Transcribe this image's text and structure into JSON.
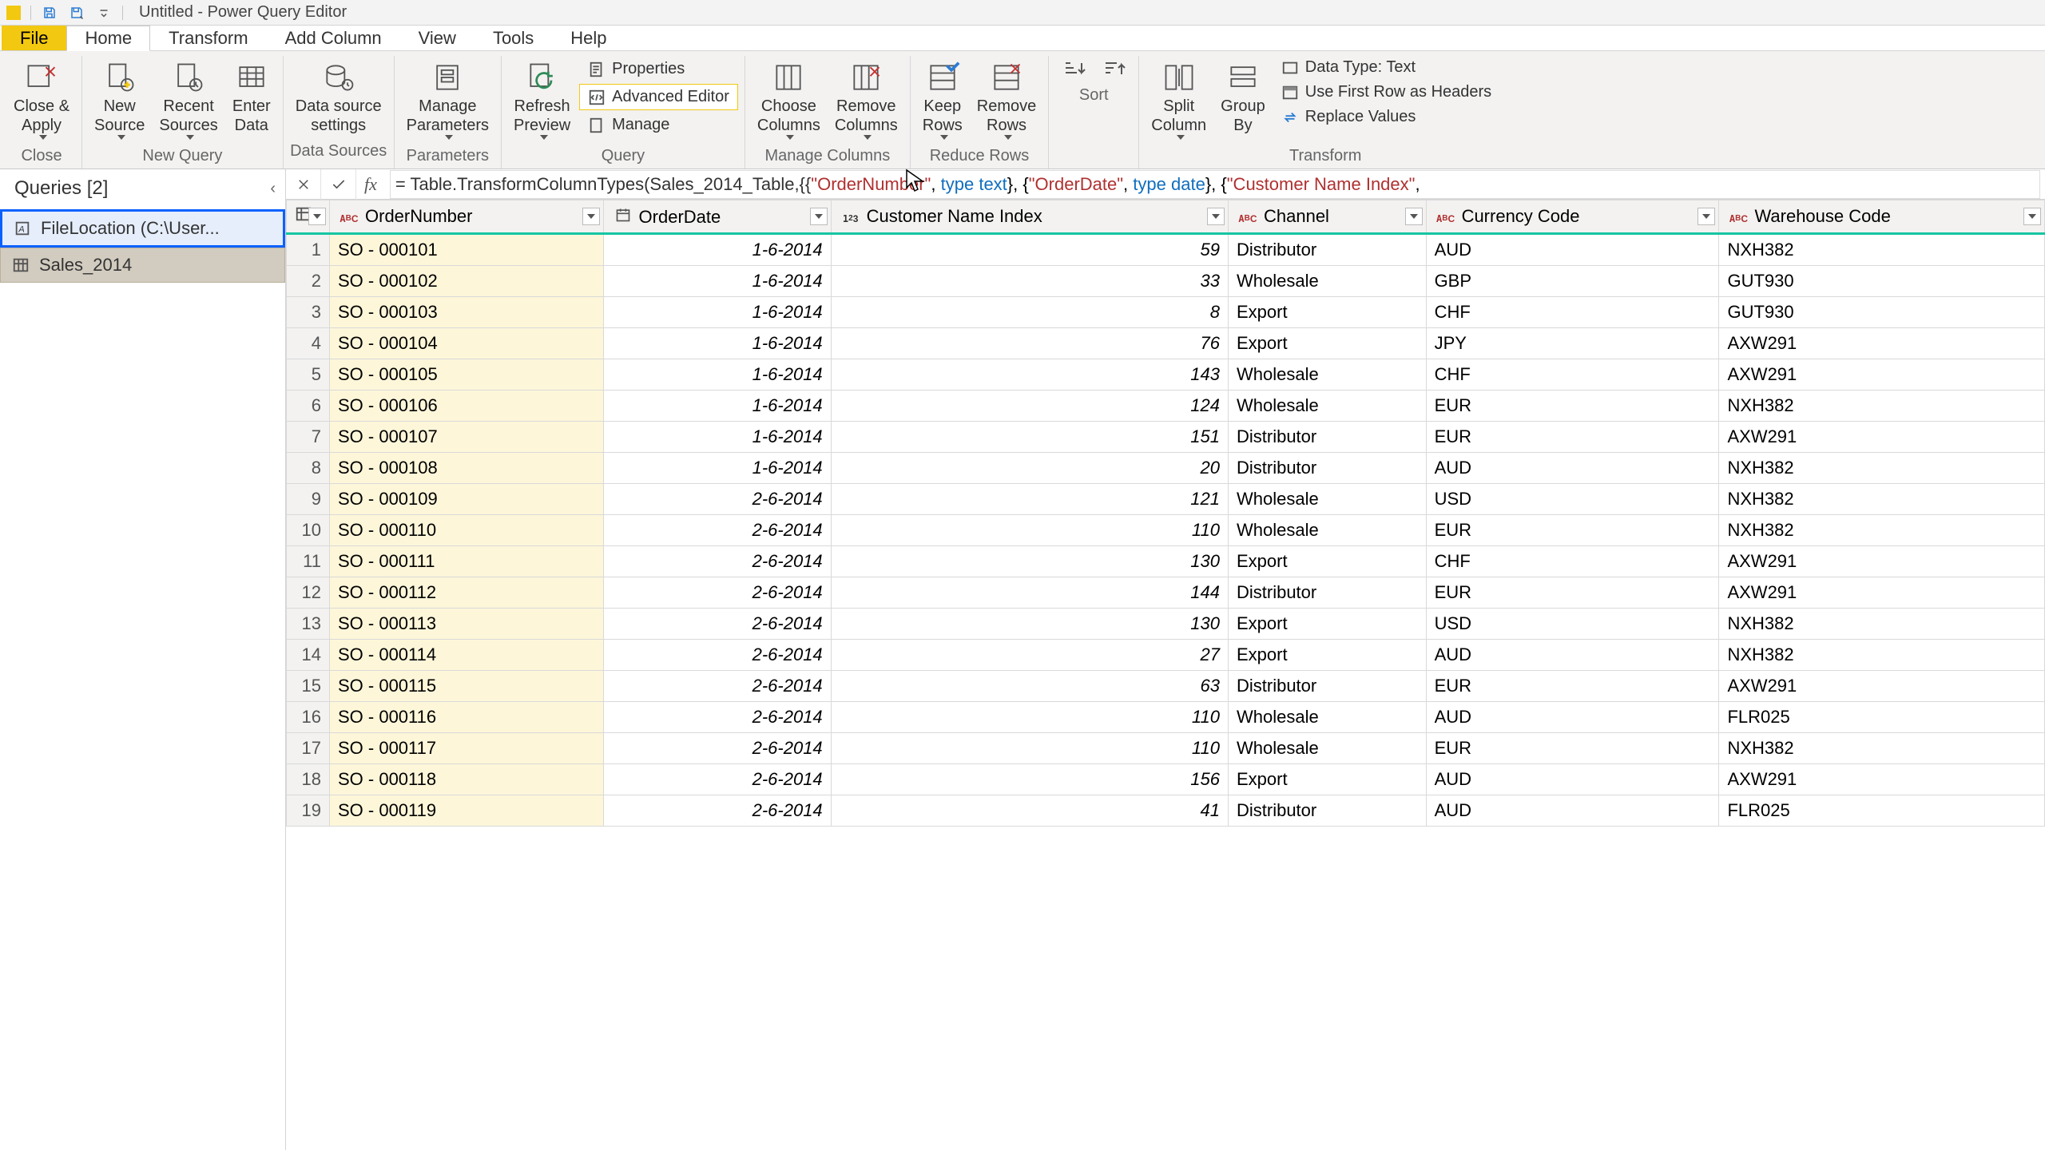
{
  "window": {
    "title": "Untitled - Power Query Editor"
  },
  "menu": {
    "file": "File",
    "tabs": [
      "Home",
      "Transform",
      "Add Column",
      "View",
      "Tools",
      "Help"
    ],
    "active": "Home"
  },
  "ribbon": {
    "groups": {
      "close": {
        "label": "Close",
        "close_apply": "Close &\nApply"
      },
      "newquery": {
        "label": "New Query",
        "new_source": "New\nSource",
        "recent_sources": "Recent\nSources",
        "enter_data": "Enter\nData"
      },
      "datasources": {
        "label": "Data Sources",
        "settings": "Data source\nsettings"
      },
      "parameters": {
        "label": "Parameters",
        "manage": "Manage\nParameters"
      },
      "query": {
        "label": "Query",
        "refresh": "Refresh\nPreview",
        "properties": "Properties",
        "advanced": "Advanced Editor",
        "manageq": "Manage"
      },
      "cols": {
        "label": "Manage Columns",
        "choose": "Choose\nColumns",
        "remove": "Remove\nColumns"
      },
      "rows": {
        "label": "Reduce Rows",
        "keep": "Keep\nRows",
        "removerows": "Remove\nRows"
      },
      "sort": {
        "label": "Sort"
      },
      "transform": {
        "label": "Transform",
        "split": "Split\nColumn",
        "group": "Group\nBy",
        "datatype": "Data Type: Text",
        "firstrow": "Use First Row as Headers",
        "replace": "Replace Values"
      }
    }
  },
  "formula": {
    "prefix": "= Table.TransformColumnTypes(Sales_2014_Table,{{",
    "s1": "\"OrderNumber\"",
    "p1": ", ",
    "kw1": "type",
    "p1b": " ",
    "kw1b": "text",
    "p2": "}, {",
    "s2": "\"OrderDate\"",
    "p3": ", ",
    "kw2": "type",
    "p3b": " ",
    "kw2b": "date",
    "p4": "}, {",
    "s3": "\"Customer Name Index\"",
    "p5": ","
  },
  "queries": {
    "heading": "Queries [2]",
    "items": [
      {
        "label": "FileLocation (C:\\User..."
      },
      {
        "label": "Sales_2014"
      }
    ]
  },
  "columns": [
    "OrderNumber",
    "OrderDate",
    "Customer Name Index",
    "Channel",
    "Currency Code",
    "Warehouse Code"
  ],
  "rows": [
    {
      "n": 1,
      "OrderNumber": "SO - 000101",
      "OrderDate": "1-6-2014",
      "Customer Name Index": 59,
      "Channel": "Distributor",
      "Currency Code": "AUD",
      "Warehouse Code": "NXH382"
    },
    {
      "n": 2,
      "OrderNumber": "SO - 000102",
      "OrderDate": "1-6-2014",
      "Customer Name Index": 33,
      "Channel": "Wholesale",
      "Currency Code": "GBP",
      "Warehouse Code": "GUT930"
    },
    {
      "n": 3,
      "OrderNumber": "SO - 000103",
      "OrderDate": "1-6-2014",
      "Customer Name Index": 8,
      "Channel": "Export",
      "Currency Code": "CHF",
      "Warehouse Code": "GUT930"
    },
    {
      "n": 4,
      "OrderNumber": "SO - 000104",
      "OrderDate": "1-6-2014",
      "Customer Name Index": 76,
      "Channel": "Export",
      "Currency Code": "JPY",
      "Warehouse Code": "AXW291"
    },
    {
      "n": 5,
      "OrderNumber": "SO - 000105",
      "OrderDate": "1-6-2014",
      "Customer Name Index": 143,
      "Channel": "Wholesale",
      "Currency Code": "CHF",
      "Warehouse Code": "AXW291"
    },
    {
      "n": 6,
      "OrderNumber": "SO - 000106",
      "OrderDate": "1-6-2014",
      "Customer Name Index": 124,
      "Channel": "Wholesale",
      "Currency Code": "EUR",
      "Warehouse Code": "NXH382"
    },
    {
      "n": 7,
      "OrderNumber": "SO - 000107",
      "OrderDate": "1-6-2014",
      "Customer Name Index": 151,
      "Channel": "Distributor",
      "Currency Code": "EUR",
      "Warehouse Code": "AXW291"
    },
    {
      "n": 8,
      "OrderNumber": "SO - 000108",
      "OrderDate": "1-6-2014",
      "Customer Name Index": 20,
      "Channel": "Distributor",
      "Currency Code": "AUD",
      "Warehouse Code": "NXH382"
    },
    {
      "n": 9,
      "OrderNumber": "SO - 000109",
      "OrderDate": "2-6-2014",
      "Customer Name Index": 121,
      "Channel": "Wholesale",
      "Currency Code": "USD",
      "Warehouse Code": "NXH382"
    },
    {
      "n": 10,
      "OrderNumber": "SO - 000110",
      "OrderDate": "2-6-2014",
      "Customer Name Index": 110,
      "Channel": "Wholesale",
      "Currency Code": "EUR",
      "Warehouse Code": "NXH382"
    },
    {
      "n": 11,
      "OrderNumber": "SO - 000111",
      "OrderDate": "2-6-2014",
      "Customer Name Index": 130,
      "Channel": "Export",
      "Currency Code": "CHF",
      "Warehouse Code": "AXW291"
    },
    {
      "n": 12,
      "OrderNumber": "SO - 000112",
      "OrderDate": "2-6-2014",
      "Customer Name Index": 144,
      "Channel": "Distributor",
      "Currency Code": "EUR",
      "Warehouse Code": "AXW291"
    },
    {
      "n": 13,
      "OrderNumber": "SO - 000113",
      "OrderDate": "2-6-2014",
      "Customer Name Index": 130,
      "Channel": "Export",
      "Currency Code": "USD",
      "Warehouse Code": "NXH382"
    },
    {
      "n": 14,
      "OrderNumber": "SO - 000114",
      "OrderDate": "2-6-2014",
      "Customer Name Index": 27,
      "Channel": "Export",
      "Currency Code": "AUD",
      "Warehouse Code": "NXH382"
    },
    {
      "n": 15,
      "OrderNumber": "SO - 000115",
      "OrderDate": "2-6-2014",
      "Customer Name Index": 63,
      "Channel": "Distributor",
      "Currency Code": "EUR",
      "Warehouse Code": "AXW291"
    },
    {
      "n": 16,
      "OrderNumber": "SO - 000116",
      "OrderDate": "2-6-2014",
      "Customer Name Index": 110,
      "Channel": "Wholesale",
      "Currency Code": "AUD",
      "Warehouse Code": "FLR025"
    },
    {
      "n": 17,
      "OrderNumber": "SO - 000117",
      "OrderDate": "2-6-2014",
      "Customer Name Index": 110,
      "Channel": "Wholesale",
      "Currency Code": "EUR",
      "Warehouse Code": "NXH382"
    },
    {
      "n": 18,
      "OrderNumber": "SO - 000118",
      "OrderDate": "2-6-2014",
      "Customer Name Index": 156,
      "Channel": "Export",
      "Currency Code": "AUD",
      "Warehouse Code": "AXW291"
    },
    {
      "n": 19,
      "OrderNumber": "SO - 000119",
      "OrderDate": "2-6-2014",
      "Customer Name Index": 41,
      "Channel": "Distributor",
      "Currency Code": "AUD",
      "Warehouse Code": "FLR025"
    }
  ]
}
